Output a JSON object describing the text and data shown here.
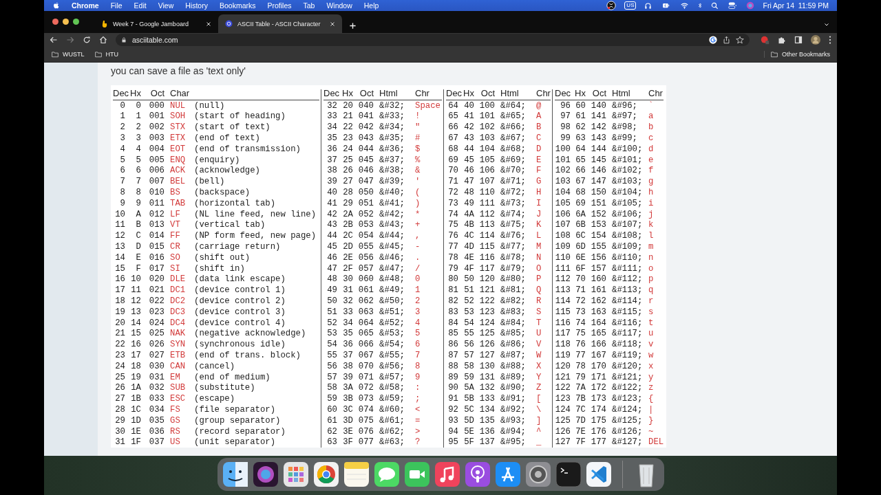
{
  "menu_bar": {
    "app": "Chrome",
    "items": [
      "File",
      "Edit",
      "View",
      "History",
      "Bookmarks",
      "Profiles",
      "Tab",
      "Window",
      "Help"
    ],
    "input_source": "US",
    "clock": "Fri Apr 14  11:59 PM"
  },
  "tabs": [
    {
      "title": "Week 7 - Google Jamboard",
      "selected": false
    },
    {
      "title": "ASCII Table - ASCII Character",
      "selected": true
    }
  ],
  "address_bar": {
    "value": "asciitable.com"
  },
  "bookmarks": [
    "WUSTL",
    "HTU"
  ],
  "other_bookmarks": "Other Bookmarks",
  "page": {
    "intro": "you can save a file as 'text only'",
    "table": {
      "blocks": [
        {
          "kind": "control",
          "columns": [
            "Dec",
            "Hx",
            "Oct",
            "Char"
          ],
          "rows": [
            [
              "0",
              "0",
              "000",
              "NUL",
              "(null)"
            ],
            [
              "1",
              "1",
              "001",
              "SOH",
              "(start of heading)"
            ],
            [
              "2",
              "2",
              "002",
              "STX",
              "(start of text)"
            ],
            [
              "3",
              "3",
              "003",
              "ETX",
              "(end of text)"
            ],
            [
              "4",
              "4",
              "004",
              "EOT",
              "(end of transmission)"
            ],
            [
              "5",
              "5",
              "005",
              "ENQ",
              "(enquiry)"
            ],
            [
              "6",
              "6",
              "006",
              "ACK",
              "(acknowledge)"
            ],
            [
              "7",
              "7",
              "007",
              "BEL",
              "(bell)"
            ],
            [
              "8",
              "8",
              "010",
              "BS",
              "(backspace)"
            ],
            [
              "9",
              "9",
              "011",
              "TAB",
              "(horizontal tab)"
            ],
            [
              "10",
              "A",
              "012",
              "LF",
              "(NL line feed, new line)"
            ],
            [
              "11",
              "B",
              "013",
              "VT",
              "(vertical tab)"
            ],
            [
              "12",
              "C",
              "014",
              "FF",
              "(NP form feed, new page)"
            ],
            [
              "13",
              "D",
              "015",
              "CR",
              "(carriage return)"
            ],
            [
              "14",
              "E",
              "016",
              "SO",
              "(shift out)"
            ],
            [
              "15",
              "F",
              "017",
              "SI",
              "(shift in)"
            ],
            [
              "16",
              "10",
              "020",
              "DLE",
              "(data link escape)"
            ],
            [
              "17",
              "11",
              "021",
              "DC1",
              "(device control 1)"
            ],
            [
              "18",
              "12",
              "022",
              "DC2",
              "(device control 2)"
            ],
            [
              "19",
              "13",
              "023",
              "DC3",
              "(device control 3)"
            ],
            [
              "20",
              "14",
              "024",
              "DC4",
              "(device control 4)"
            ],
            [
              "21",
              "15",
              "025",
              "NAK",
              "(negative acknowledge)"
            ],
            [
              "22",
              "16",
              "026",
              "SYN",
              "(synchronous idle)"
            ],
            [
              "23",
              "17",
              "027",
              "ETB",
              "(end of trans. block)"
            ],
            [
              "24",
              "18",
              "030",
              "CAN",
              "(cancel)"
            ],
            [
              "25",
              "19",
              "031",
              "EM",
              "(end of medium)"
            ],
            [
              "26",
              "1A",
              "032",
              "SUB",
              "(substitute)"
            ],
            [
              "27",
              "1B",
              "033",
              "ESC",
              "(escape)"
            ],
            [
              "28",
              "1C",
              "034",
              "FS",
              "(file separator)"
            ],
            [
              "29",
              "1D",
              "035",
              "GS",
              "(group separator)"
            ],
            [
              "30",
              "1E",
              "036",
              "RS",
              "(record separator)"
            ],
            [
              "31",
              "1F",
              "037",
              "US",
              "(unit separator)"
            ]
          ]
        },
        {
          "kind": "printable",
          "columns": [
            "Dec",
            "Hx",
            "Oct",
            "Html",
            "Chr"
          ],
          "rows": [
            [
              "32",
              "20",
              "040",
              "&#32;",
              "Space"
            ],
            [
              "33",
              "21",
              "041",
              "&#33;",
              "!"
            ],
            [
              "34",
              "22",
              "042",
              "&#34;",
              "\""
            ],
            [
              "35",
              "23",
              "043",
              "&#35;",
              "#"
            ],
            [
              "36",
              "24",
              "044",
              "&#36;",
              "$"
            ],
            [
              "37",
              "25",
              "045",
              "&#37;",
              "%"
            ],
            [
              "38",
              "26",
              "046",
              "&#38;",
              "&"
            ],
            [
              "39",
              "27",
              "047",
              "&#39;",
              "'"
            ],
            [
              "40",
              "28",
              "050",
              "&#40;",
              "("
            ],
            [
              "41",
              "29",
              "051",
              "&#41;",
              ")"
            ],
            [
              "42",
              "2A",
              "052",
              "&#42;",
              "*"
            ],
            [
              "43",
              "2B",
              "053",
              "&#43;",
              "+"
            ],
            [
              "44",
              "2C",
              "054",
              "&#44;",
              ","
            ],
            [
              "45",
              "2D",
              "055",
              "&#45;",
              "-"
            ],
            [
              "46",
              "2E",
              "056",
              "&#46;",
              "."
            ],
            [
              "47",
              "2F",
              "057",
              "&#47;",
              "/"
            ],
            [
              "48",
              "30",
              "060",
              "&#48;",
              "0"
            ],
            [
              "49",
              "31",
              "061",
              "&#49;",
              "1"
            ],
            [
              "50",
              "32",
              "062",
              "&#50;",
              "2"
            ],
            [
              "51",
              "33",
              "063",
              "&#51;",
              "3"
            ],
            [
              "52",
              "34",
              "064",
              "&#52;",
              "4"
            ],
            [
              "53",
              "35",
              "065",
              "&#53;",
              "5"
            ],
            [
              "54",
              "36",
              "066",
              "&#54;",
              "6"
            ],
            [
              "55",
              "37",
              "067",
              "&#55;",
              "7"
            ],
            [
              "56",
              "38",
              "070",
              "&#56;",
              "8"
            ],
            [
              "57",
              "39",
              "071",
              "&#57;",
              "9"
            ],
            [
              "58",
              "3A",
              "072",
              "&#58;",
              ":"
            ],
            [
              "59",
              "3B",
              "073",
              "&#59;",
              ";"
            ],
            [
              "60",
              "3C",
              "074",
              "&#60;",
              "<"
            ],
            [
              "61",
              "3D",
              "075",
              "&#61;",
              "="
            ],
            [
              "62",
              "3E",
              "076",
              "&#62;",
              ">"
            ],
            [
              "63",
              "3F",
              "077",
              "&#63;",
              "?"
            ]
          ]
        },
        {
          "kind": "printable",
          "columns": [
            "Dec",
            "Hx",
            "Oct",
            "Html",
            "Chr"
          ],
          "rows": [
            [
              "64",
              "40",
              "100",
              "&#64;",
              "@"
            ],
            [
              "65",
              "41",
              "101",
              "&#65;",
              "A"
            ],
            [
              "66",
              "42",
              "102",
              "&#66;",
              "B"
            ],
            [
              "67",
              "43",
              "103",
              "&#67;",
              "C"
            ],
            [
              "68",
              "44",
              "104",
              "&#68;",
              "D"
            ],
            [
              "69",
              "45",
              "105",
              "&#69;",
              "E"
            ],
            [
              "70",
              "46",
              "106",
              "&#70;",
              "F"
            ],
            [
              "71",
              "47",
              "107",
              "&#71;",
              "G"
            ],
            [
              "72",
              "48",
              "110",
              "&#72;",
              "H"
            ],
            [
              "73",
              "49",
              "111",
              "&#73;",
              "I"
            ],
            [
              "74",
              "4A",
              "112",
              "&#74;",
              "J"
            ],
            [
              "75",
              "4B",
              "113",
              "&#75;",
              "K"
            ],
            [
              "76",
              "4C",
              "114",
              "&#76;",
              "L"
            ],
            [
              "77",
              "4D",
              "115",
              "&#77;",
              "M"
            ],
            [
              "78",
              "4E",
              "116",
              "&#78;",
              "N"
            ],
            [
              "79",
              "4F",
              "117",
              "&#79;",
              "O"
            ],
            [
              "80",
              "50",
              "120",
              "&#80;",
              "P"
            ],
            [
              "81",
              "51",
              "121",
              "&#81;",
              "Q"
            ],
            [
              "82",
              "52",
              "122",
              "&#82;",
              "R"
            ],
            [
              "83",
              "53",
              "123",
              "&#83;",
              "S"
            ],
            [
              "84",
              "54",
              "124",
              "&#84;",
              "T"
            ],
            [
              "85",
              "55",
              "125",
              "&#85;",
              "U"
            ],
            [
              "86",
              "56",
              "126",
              "&#86;",
              "V"
            ],
            [
              "87",
              "57",
              "127",
              "&#87;",
              "W"
            ],
            [
              "88",
              "58",
              "130",
              "&#88;",
              "X"
            ],
            [
              "89",
              "59",
              "131",
              "&#89;",
              "Y"
            ],
            [
              "90",
              "5A",
              "132",
              "&#90;",
              "Z"
            ],
            [
              "91",
              "5B",
              "133",
              "&#91;",
              "["
            ],
            [
              "92",
              "5C",
              "134",
              "&#92;",
              "\\"
            ],
            [
              "93",
              "5D",
              "135",
              "&#93;",
              "]"
            ],
            [
              "94",
              "5E",
              "136",
              "&#94;",
              "^"
            ],
            [
              "95",
              "5F",
              "137",
              "&#95;",
              "_"
            ]
          ]
        },
        {
          "kind": "printable",
          "columns": [
            "Dec",
            "Hx",
            "Oct",
            "Html",
            "Chr"
          ],
          "rows": [
            [
              "96",
              "60",
              "140",
              "&#96;",
              "`"
            ],
            [
              "97",
              "61",
              "141",
              "&#97;",
              "a"
            ],
            [
              "98",
              "62",
              "142",
              "&#98;",
              "b"
            ],
            [
              "99",
              "63",
              "143",
              "&#99;",
              "c"
            ],
            [
              "100",
              "64",
              "144",
              "&#100;",
              "d"
            ],
            [
              "101",
              "65",
              "145",
              "&#101;",
              "e"
            ],
            [
              "102",
              "66",
              "146",
              "&#102;",
              "f"
            ],
            [
              "103",
              "67",
              "147",
              "&#103;",
              "g"
            ],
            [
              "104",
              "68",
              "150",
              "&#104;",
              "h"
            ],
            [
              "105",
              "69",
              "151",
              "&#105;",
              "i"
            ],
            [
              "106",
              "6A",
              "152",
              "&#106;",
              "j"
            ],
            [
              "107",
              "6B",
              "153",
              "&#107;",
              "k"
            ],
            [
              "108",
              "6C",
              "154",
              "&#108;",
              "l"
            ],
            [
              "109",
              "6D",
              "155",
              "&#109;",
              "m"
            ],
            [
              "110",
              "6E",
              "156",
              "&#110;",
              "n"
            ],
            [
              "111",
              "6F",
              "157",
              "&#111;",
              "o"
            ],
            [
              "112",
              "70",
              "160",
              "&#112;",
              "p"
            ],
            [
              "113",
              "71",
              "161",
              "&#113;",
              "q"
            ],
            [
              "114",
              "72",
              "162",
              "&#114;",
              "r"
            ],
            [
              "115",
              "73",
              "163",
              "&#115;",
              "s"
            ],
            [
              "116",
              "74",
              "164",
              "&#116;",
              "t"
            ],
            [
              "117",
              "75",
              "165",
              "&#117;",
              "u"
            ],
            [
              "118",
              "76",
              "166",
              "&#118;",
              "v"
            ],
            [
              "119",
              "77",
              "167",
              "&#119;",
              "w"
            ],
            [
              "120",
              "78",
              "170",
              "&#120;",
              "x"
            ],
            [
              "121",
              "79",
              "171",
              "&#121;",
              "y"
            ],
            [
              "122",
              "7A",
              "172",
              "&#122;",
              "z"
            ],
            [
              "123",
              "7B",
              "173",
              "&#123;",
              "{"
            ],
            [
              "124",
              "7C",
              "174",
              "&#124;",
              "|"
            ],
            [
              "125",
              "7D",
              "175",
              "&#125;",
              "}"
            ],
            [
              "126",
              "7E",
              "176",
              "&#126;",
              "~"
            ],
            [
              "127",
              "7F",
              "177",
              "&#127;",
              "DEL"
            ]
          ]
        }
      ]
    }
  },
  "dock": [
    {
      "kind": "finder"
    },
    {
      "kind": "siri"
    },
    {
      "kind": "launchpad"
    },
    {
      "kind": "chrome"
    },
    {
      "kind": "notes"
    },
    {
      "kind": "messages"
    },
    {
      "kind": "facetime"
    },
    {
      "kind": "music"
    },
    {
      "kind": "podcasts"
    },
    {
      "kind": "appstore"
    },
    {
      "kind": "settings"
    },
    {
      "kind": "terminal"
    },
    {
      "kind": "vscode"
    },
    {
      "kind": "trash"
    }
  ]
}
